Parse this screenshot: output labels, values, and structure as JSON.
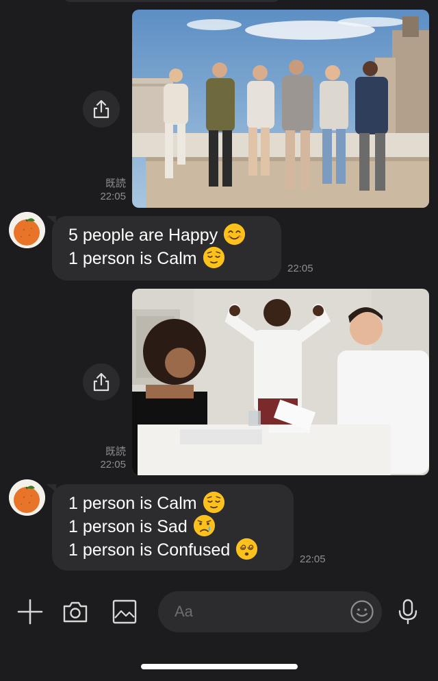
{
  "messages": [
    {
      "type": "image",
      "description": "Six young people sitting on a rooftop ledge",
      "read_label": "既読",
      "time": "22:05"
    },
    {
      "type": "text",
      "lines": [
        {
          "text": "5 people are Happy",
          "emoji": "smiling-face-icon"
        },
        {
          "text": "1 person is Calm",
          "emoji": "relieved-face-icon"
        }
      ],
      "time": "22:05"
    },
    {
      "type": "image",
      "description": "Three people at a table, one man standing with raised hands",
      "read_label": "既読",
      "time": "22:05"
    },
    {
      "type": "text",
      "lines": [
        {
          "text": "1 person is Calm",
          "emoji": "relieved-face-icon"
        },
        {
          "text": "1 person is Sad",
          "emoji": "crying-face-icon"
        },
        {
          "text": "1 person is Confused",
          "emoji": "dizzy-face-icon"
        }
      ],
      "time": "22:05"
    }
  ],
  "composer": {
    "placeholder": "Aa"
  },
  "colors": {
    "background": "#1c1c1e",
    "bubble": "#2c2c2e",
    "meta_text": "#8e8e93",
    "icon": "#d8d8d8"
  }
}
